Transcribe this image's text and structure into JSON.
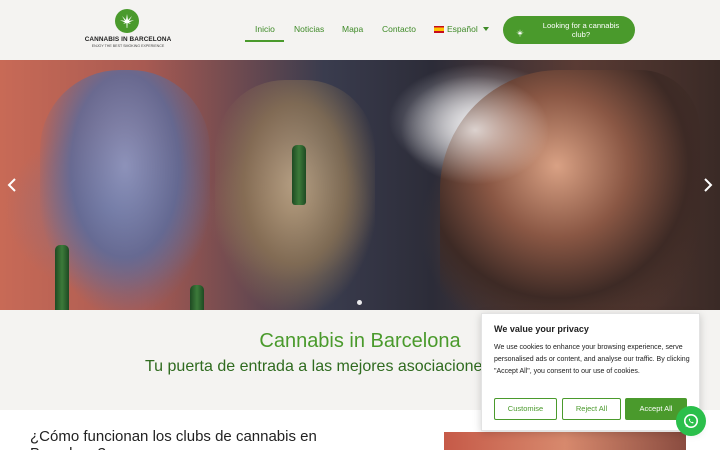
{
  "brand": {
    "name": "CANNABIS IN BARCELONA",
    "tagline": "ENJOY THE BEST SMOKING EXPERIENCE",
    "logo_icon": "cannabis-leaf-icon"
  },
  "nav": {
    "items": [
      {
        "label": "Inicio",
        "active": true
      },
      {
        "label": "Noticias",
        "active": false
      },
      {
        "label": "Mapa",
        "active": false
      },
      {
        "label": "Contacto",
        "active": false
      }
    ],
    "language": {
      "label": "Español",
      "flag_icon": "spain-flag-icon"
    }
  },
  "cta": {
    "label": "Looking for a cannabis club?",
    "icon": "cannabis-leaf-icon"
  },
  "hero": {
    "prev_icon": "chevron-left-icon",
    "next_icon": "chevron-right-icon"
  },
  "intro": {
    "title": "Cannabis in Barcelona",
    "subtitle": "Tu puerta de entrada a las mejores asociaciones"
  },
  "section": {
    "title": "¿Cómo funcionan los clubs de cannabis en Barcelona?"
  },
  "cookie": {
    "title": "We value your privacy",
    "text": "We use cookies to enhance your browsing experience, serve personalised ads or content, and analyse our traffic. By clicking \"Accept All\", you consent to our use of cookies.",
    "customise_label": "Customise",
    "reject_label": "Reject All",
    "accept_label": "Accept All"
  },
  "colors": {
    "brand_green": "#4a9a2c",
    "dark_green": "#2f6b1f",
    "header_bg": "#f4f3f1",
    "whatsapp_green": "#2bbf4b"
  }
}
